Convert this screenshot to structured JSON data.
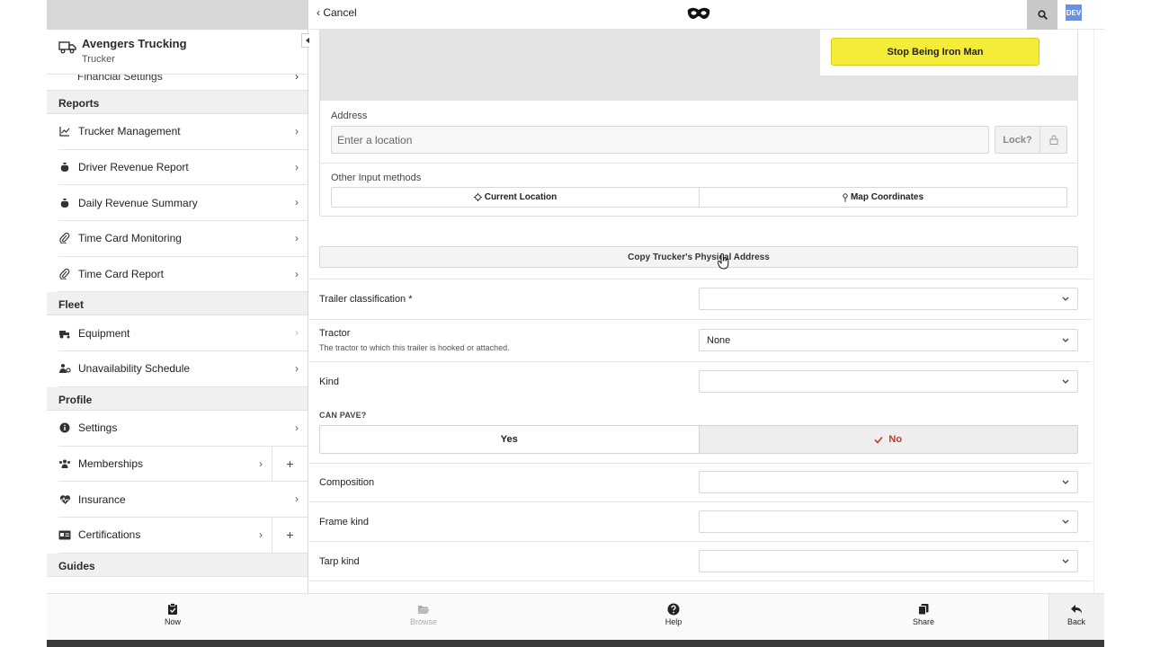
{
  "sidebar": {
    "org_name": "Avengers Trucking",
    "org_role": "Trucker",
    "cut_item": "Financial Settings",
    "sections": {
      "reports": "Reports",
      "fleet": "Fleet",
      "profile": "Profile",
      "guides": "Guides"
    },
    "reports_items": [
      "Trucker Management",
      "Driver Revenue Report",
      "Daily Revenue Summary",
      "Time Card Monitoring",
      "Time Card Report"
    ],
    "fleet_items": [
      "Equipment",
      "Unavailability Schedule"
    ],
    "profile_items": [
      "Settings",
      "Memberships",
      "Insurance",
      "Certifications"
    ],
    "plus_label": "+"
  },
  "header": {
    "cancel_label": "Cancel",
    "dev_badge": "DEV"
  },
  "location": {
    "iron_man_button": "Stop Being Iron Man",
    "address_label": "Address",
    "address_placeholder": "Enter a location",
    "lock_label": "Lock?",
    "other_methods_label": "Other Input methods",
    "current_location": "Current Location",
    "map_coordinates": "Map Coordinates"
  },
  "form": {
    "copy_button": "Copy Trucker's Physical Address",
    "trailer_classification_label": "Trailer classification *",
    "tractor_label": "Tractor",
    "tractor_help": "The tractor to which this trailer is hooked or attached.",
    "tractor_value": "None",
    "kind_label": "Kind",
    "can_pave_label": "CAN PAVE?",
    "yes_label": "Yes",
    "no_label": "No",
    "composition_label": "Composition",
    "frame_kind_label": "Frame kind",
    "tarp_kind_label": "Tarp kind"
  },
  "bottom_nav": {
    "now": "Now",
    "browse": "Browse",
    "help": "Help",
    "share": "Share",
    "back": "Back"
  },
  "colors": {
    "iron_man_yellow": "#f5ec39",
    "no_selected_red": "#c0392b",
    "dev_badge_blue": "#6b8fe3"
  }
}
